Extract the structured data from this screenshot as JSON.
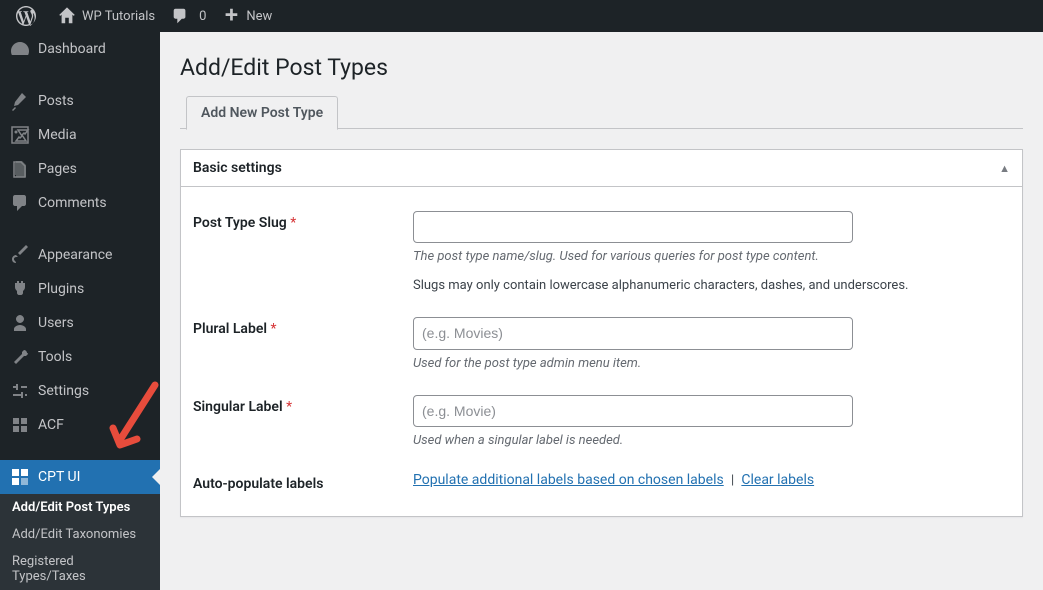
{
  "adminbar": {
    "site_name": "WP Tutorials",
    "comments_count": "0",
    "new_label": "New"
  },
  "sidebar": {
    "items": [
      {
        "label": "Dashboard"
      },
      {
        "label": "Posts"
      },
      {
        "label": "Media"
      },
      {
        "label": "Pages"
      },
      {
        "label": "Comments"
      },
      {
        "label": "Appearance"
      },
      {
        "label": "Plugins"
      },
      {
        "label": "Users"
      },
      {
        "label": "Tools"
      },
      {
        "label": "Settings"
      },
      {
        "label": "ACF"
      },
      {
        "label": "CPT UI"
      }
    ],
    "submenu": [
      {
        "label": "Add/Edit Post Types"
      },
      {
        "label": "Add/Edit Taxonomies"
      },
      {
        "label": "Registered Types/Taxes"
      }
    ]
  },
  "page": {
    "title": "Add/Edit Post Types",
    "tab_label": "Add New Post Type",
    "section_title": "Basic settings"
  },
  "fields": {
    "slug": {
      "label": "Post Type Slug",
      "desc": "The post type name/slug. Used for various queries for post type content.",
      "note": "Slugs may only contain lowercase alphanumeric characters, dashes, and underscores."
    },
    "plural": {
      "label": "Plural Label",
      "placeholder": "(e.g. Movies)",
      "desc": "Used for the post type admin menu item."
    },
    "singular": {
      "label": "Singular Label",
      "placeholder": "(e.g. Movie)",
      "desc": "Used when a singular label is needed."
    },
    "autopopulate": {
      "label": "Auto-populate labels",
      "link_populate": "Populate additional labels based on chosen labels",
      "link_clear": "Clear labels",
      "sep": "|"
    }
  }
}
